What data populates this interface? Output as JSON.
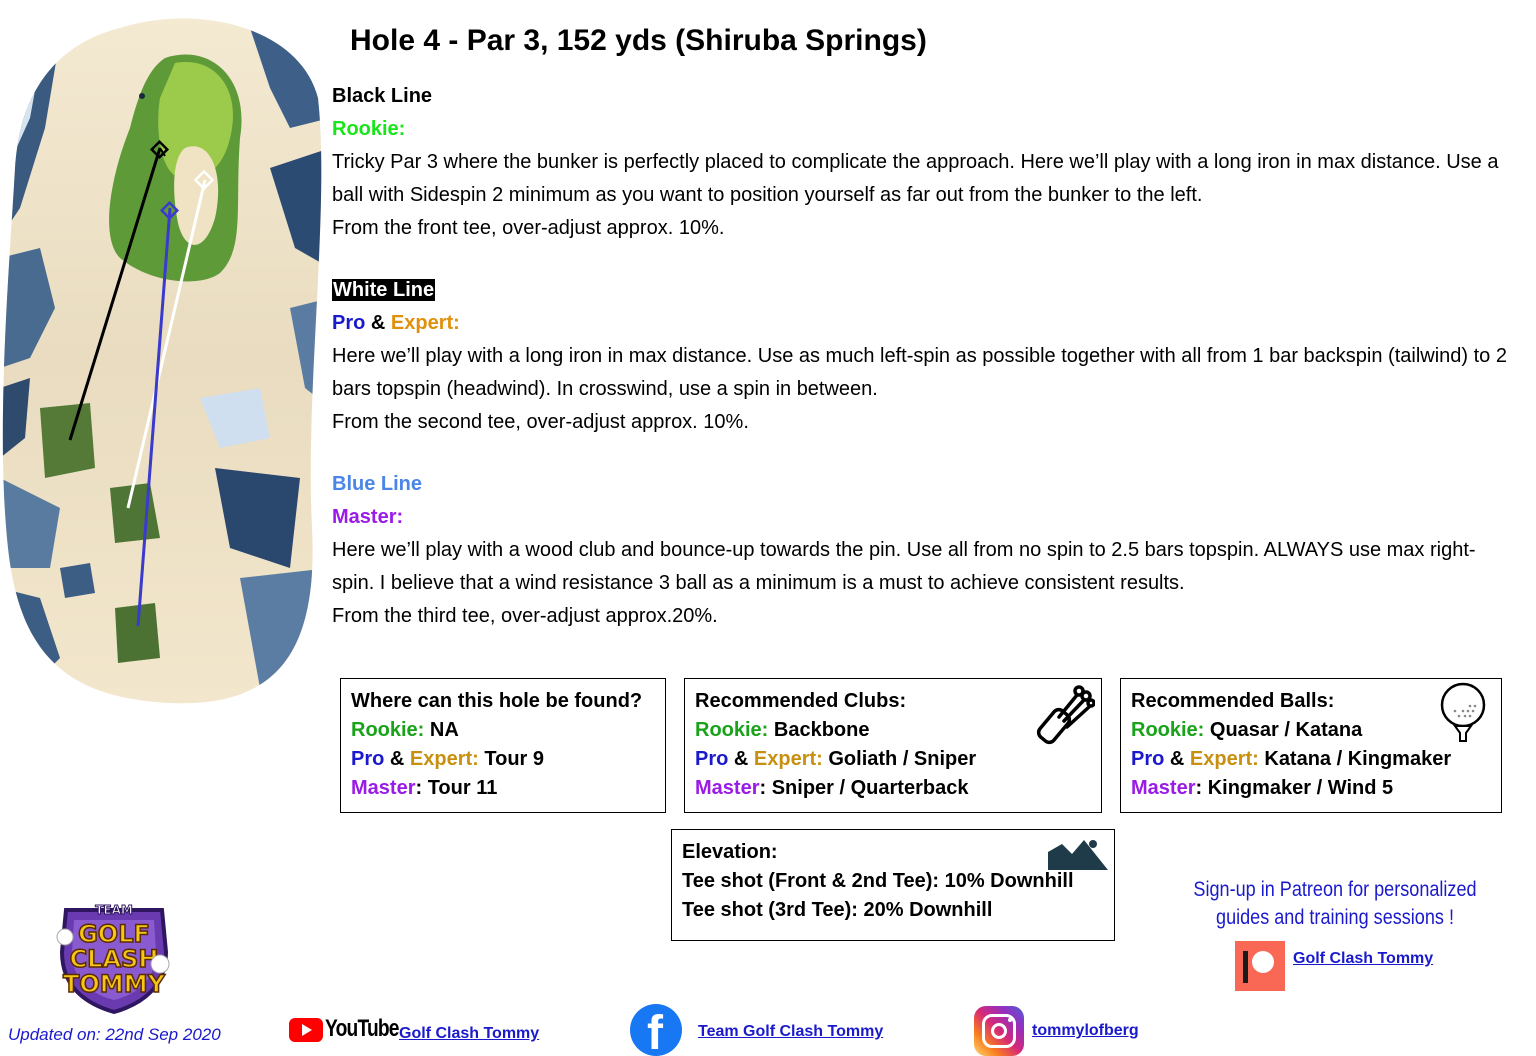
{
  "title": "Hole 4 - Par 3, 152 yds (Shiruba Springs)",
  "black_line": {
    "heading": "Black Line",
    "level": "Rookie:",
    "text": "Tricky Par 3 where the bunker is perfectly placed to complicate the approach. Here we’ll play with a long iron in max distance. Use a ball with Sidespin 2 minimum as you want to position yourself as far out from the bunker to the left.",
    "tee_note": "From the front tee, over-adjust approx. 10%."
  },
  "white_line": {
    "heading": "White Line",
    "level_pro": "Pro",
    "amp": " & ",
    "level_expert": "Expert:",
    "text": "Here we’ll play with a long iron in max distance. Use as much left-spin as possible together with all from 1 bar backspin (tailwind) to 2 bars topspin (headwind). In crosswind, use a spin in between.",
    "tee_note": "From the second tee, over-adjust approx. 10%."
  },
  "blue_line": {
    "heading": "Blue Line",
    "level": "Master:",
    "text": "Here we’ll play with a wood club and bounce-up towards the pin. Use all from no spin to 2.5 bars topspin. ALWAYS use max right-spin. I believe that a wind resistance 3 ball as a minimum is a must to achieve consistent results.",
    "tee_note": "From the third tee, over-adjust approx.20%."
  },
  "where_box": {
    "heading": "Where can this hole be found?",
    "rookie_label": "Rookie:",
    "rookie_value": " NA",
    "pro_label": "Pro",
    "amp": " & ",
    "expert_label": "Expert:",
    "pro_value": " Tour 9",
    "master_label": "Master",
    "master_value": ": Tour 11"
  },
  "clubs_box": {
    "heading": "Recommended Clubs:",
    "rookie_label": "Rookie:",
    "rookie_value": " Backbone",
    "pro_label": "Pro",
    "amp": " & ",
    "expert_label": "Expert:",
    "pro_value": " Goliath / Sniper",
    "master_label": "Master",
    "master_value": ": Sniper / Quarterback",
    "icon": "golf-bag-icon"
  },
  "balls_box": {
    "heading": "Recommended Balls:",
    "rookie_label": "Rookie:",
    "rookie_value": " Quasar / Katana",
    "pro_label": "Pro",
    "amp": " & ",
    "expert_label": "Expert:",
    "pro_value": " Katana / Kingmaker",
    "master_label": "Master",
    "master_value": ": Kingmaker / Wind 5",
    "icon": "golf-ball-icon"
  },
  "elevation_box": {
    "heading": "Elevation:",
    "line1": "Tee shot (Front & 2nd Tee): 10% Downhill",
    "line2": "Tee shot (3rd Tee): 20% Downhill",
    "icon": "mountain-icon"
  },
  "patreon": {
    "line1": "Sign-up in Patreon for personalized",
    "line2": "guides and training sessions !",
    "link": "Golf Clash Tommy"
  },
  "logo": {
    "top": "TEAM",
    "line1": "GOLF",
    "line2": "CLASH",
    "line3": "TOMMY"
  },
  "footer": {
    "updated": "Updated on: 22nd Sep 2020",
    "youtube_brand": "YouTube",
    "youtube_link": "Golf Clash Tommy",
    "facebook_link": "Team Golf Clash Tommy",
    "instagram_link": "tommylofberg"
  },
  "colors": {
    "rookie": "#19e619",
    "pro": "#1a1acc",
    "expert": "#e0900a",
    "master": "#9a1ae6",
    "blue_line": "#4a86e8",
    "link": "#1a1acc"
  }
}
